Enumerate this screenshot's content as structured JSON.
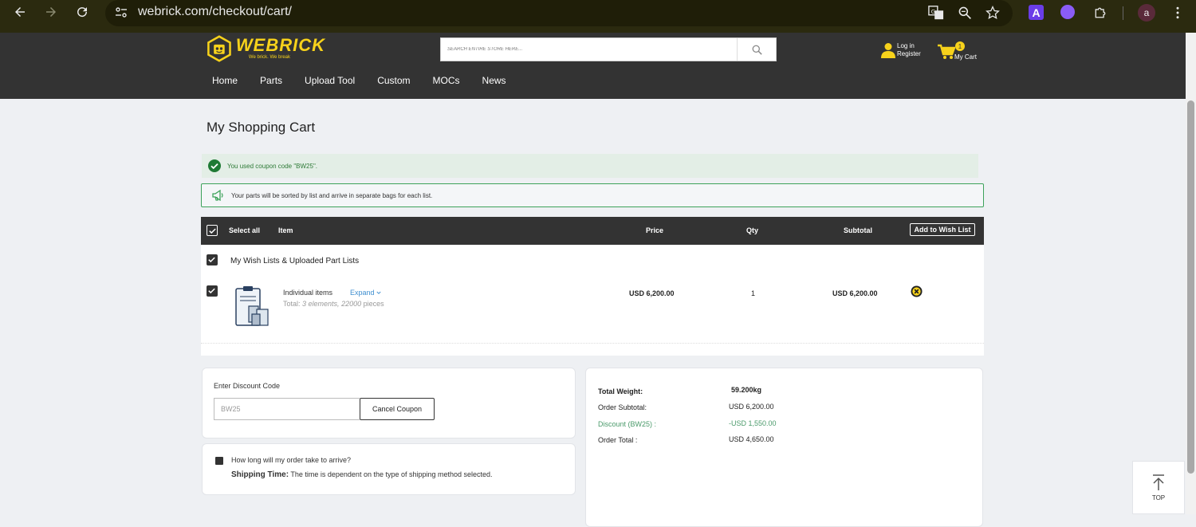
{
  "browser": {
    "url": "webrick.com/checkout/cart/",
    "profile_initial": "a",
    "ext_a_label": "A"
  },
  "header": {
    "logo_word": "WEBRICK",
    "logo_tagline": "We brick. We break",
    "search_placeholder": "SEARCH ENTIRE STORE HERE...",
    "login_label": "Log in",
    "register_label": "Register",
    "cart_count": "1",
    "cart_label": "My Cart",
    "nav": [
      "Home",
      "Parts",
      "Upload Tool",
      "Custom",
      "MOCs",
      "News"
    ]
  },
  "page": {
    "title": "My Shopping Cart",
    "coupon_message": "You used coupon code \"BW25\".",
    "info_message": "Your parts will be sorted by list and arrive in separate bags for each list."
  },
  "cart_table": {
    "select_all": "Select all",
    "col_item": "Item",
    "col_price": "Price",
    "col_qty": "Qty",
    "col_subtotal": "Subtotal",
    "wish_button": "Add to Wish List",
    "group_label": "My Wish Lists & Uploaded Part Lists",
    "item": {
      "name": "Individual items",
      "expand_label": "Expand",
      "total_prefix": "Total: ",
      "elements": "3 elements,",
      "pieces": "22000",
      "pieces_suffix": " pieces",
      "price": "USD 6,200.00",
      "qty": "1",
      "subtotal": "USD 6,200.00"
    }
  },
  "discount": {
    "label": "Enter Discount Code",
    "code": "BW25",
    "cancel_button": "Cancel Coupon"
  },
  "shipping": {
    "question": "How long will my order take to arrive?",
    "answer_label": "Shipping Time:",
    "answer_text": " The time is dependent on the type of shipping method selected."
  },
  "summary": {
    "weight_label": "Total Weight:",
    "weight_value": "59.200kg",
    "subtotal_label": "Order Subtotal:",
    "subtotal_value": "USD 6,200.00",
    "discount_label": "Discount (BW25) :",
    "discount_value": "-USD 1,550.00",
    "total_label": "Order Total :",
    "total_value": "USD 4,650.00"
  },
  "top_button": "TOP",
  "colors": {
    "brand_yellow": "#f7d21b",
    "header_dark": "#333333",
    "success_green": "#2d7a36",
    "link_blue": "#3f8fd0"
  }
}
